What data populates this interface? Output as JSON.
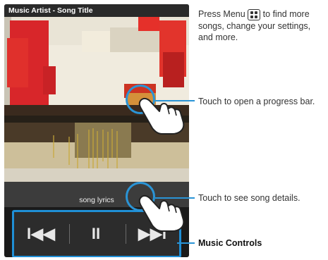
{
  "player": {
    "title": "Music Artist - Song Title",
    "lyrics": "song lyrics",
    "controls": {
      "previous": "I◀◀",
      "pause": "II",
      "next": "▶▶I"
    }
  },
  "annotations": {
    "menu_prefix": "Press Menu",
    "menu_suffix": "to find more songs, change your settings, and more.",
    "progress": "Touch to open a progress bar.",
    "details": "Touch to see song details.",
    "controls": "Music Controls"
  },
  "colors": {
    "accent": "#1f8fd6",
    "title_bar": "#2a2a2a",
    "art_red": "#d8262a"
  }
}
